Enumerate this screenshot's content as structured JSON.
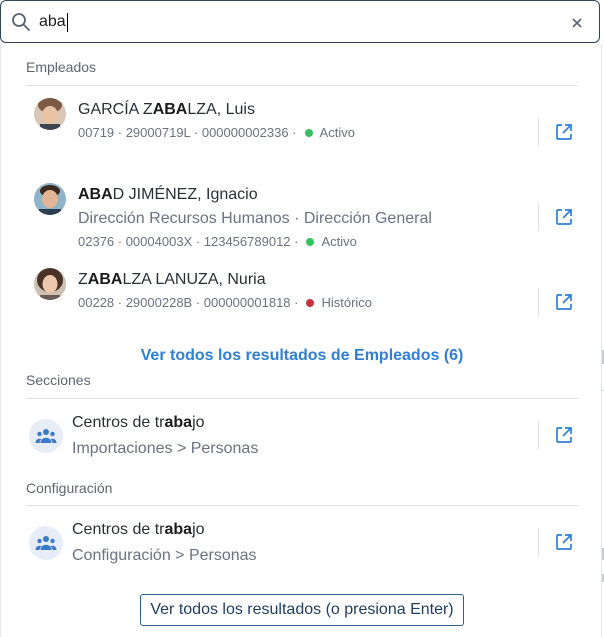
{
  "search": {
    "value": "aba",
    "placeholder": ""
  },
  "sections": {
    "employees": {
      "heading": "Empleados",
      "items": [
        {
          "title_pre": "GARCÍA Z",
          "title_match": "ABA",
          "title_post": "LZA, Luis",
          "line1": "00719 · 29000719L · 000000002336 ·",
          "status": "Activo",
          "status_color": "#33c25f"
        },
        {
          "title_pre": "",
          "title_match": "ABA",
          "title_post": "D JIMÉNEZ, Ignacio",
          "org": "Dirección Recursos Humanos · Dirección General",
          "line1": "02376 · 00004003X · 123456789012 ·",
          "status": "Activo",
          "status_color": "#33c25f"
        },
        {
          "title_pre": "Z",
          "title_match": "ABA",
          "title_post": "LZA LANUZA, Nuria",
          "line1": "00228 · 29000228B · 000000001818 ·",
          "status": "Histórico",
          "status_color": "#c8333b"
        }
      ],
      "see_all": "Ver todos los resultados de Empleados (6)"
    },
    "sections_group": {
      "heading": "Secciones",
      "item": {
        "title_pre": "Centros de tr",
        "title_match": "aba",
        "title_post": "jo",
        "path": "Importaciones > Personas"
      }
    },
    "config": {
      "heading": "Configuración",
      "item": {
        "title_pre": "Centros de tr",
        "title_match": "aba",
        "title_post": "jo",
        "path": "Configuración > Personas"
      }
    }
  },
  "footer": {
    "see_all_button": "Ver todos los resultados (o presiona Enter)"
  },
  "colors": {
    "accent": "#2f7fd3",
    "border": "#31465a",
    "active": "#33c25f",
    "historic": "#c8333b"
  },
  "icons": [
    "search-icon",
    "close-icon",
    "external-link-icon",
    "people-group-icon"
  ]
}
